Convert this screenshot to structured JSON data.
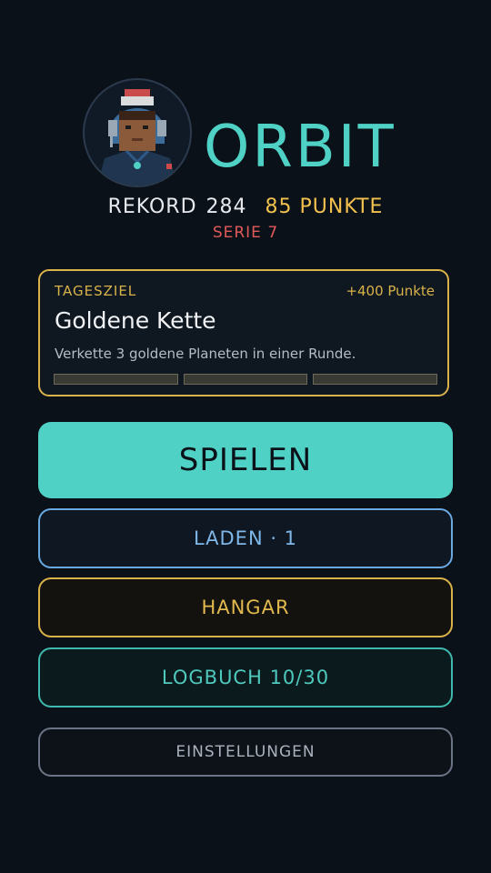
{
  "header": {
    "title": "ORBIT",
    "record_label": "REKORD",
    "record_value": "284",
    "points": "85 PUNKTE",
    "streak": "SERIE 7"
  },
  "daily_goal": {
    "label": "TAGESZIEL",
    "reward": "+400 Punkte",
    "name": "Goldene Kette",
    "description": "Verkette 3 goldene Planeten in einer Runde.",
    "progress": 0,
    "total": 3
  },
  "menu": {
    "play": "SPIELEN",
    "load": "LADEN · 1",
    "hangar": "HANGAR",
    "logbook": "LOGBUCH 10/30",
    "settings": "EINSTELLUNGEN"
  },
  "colors": {
    "accent": "#4fd1c5",
    "gold": "#d9b24a",
    "blue": "#6aa9e0",
    "red": "#e05a5a",
    "background": "#0b1118"
  },
  "icons": {
    "avatar": "pilot-avatar-icon"
  }
}
